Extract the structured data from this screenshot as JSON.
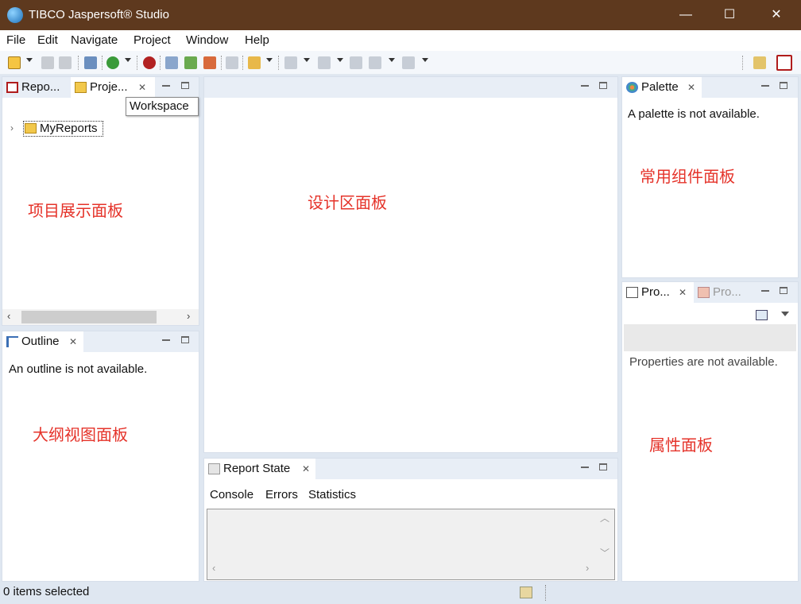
{
  "window": {
    "title": "TIBCO Jaspersoft® Studio",
    "minimize_glyph": "—",
    "maximize_glyph": "☐",
    "close_glyph": "✕"
  },
  "menu": [
    "File",
    "Edit",
    "Navigate",
    "Project",
    "Window",
    "Help"
  ],
  "project_panel": {
    "tabs": [
      "Repo...",
      "Proje..."
    ],
    "tooltip": "Workspace",
    "tree_item": "MyReports",
    "note": "项目展示面板"
  },
  "outline_panel": {
    "tab": "Outline",
    "message": "An outline is not available.",
    "note": "大纲视图面板"
  },
  "design_panel": {
    "note": "设计区面板"
  },
  "report_state_panel": {
    "tab": "Report State",
    "subtabs": [
      "Console",
      "Errors",
      "Statistics"
    ]
  },
  "palette_panel": {
    "tab": "Palette",
    "message": "A palette is not available.",
    "note": "常用组件面板"
  },
  "properties_panel": {
    "tabs": [
      "Pro...",
      "Pro..."
    ],
    "message": "Properties are not available.",
    "note": "属性面板"
  },
  "statusbar": {
    "text": "0 items selected"
  },
  "icons": {
    "app": "jaspersoft-logo-icon",
    "close_tab": "close-x-icon"
  },
  "colors": {
    "titlebar": "#5e391e",
    "note_text": "#e5332a",
    "workspace_bg": "#dfe7f1"
  }
}
